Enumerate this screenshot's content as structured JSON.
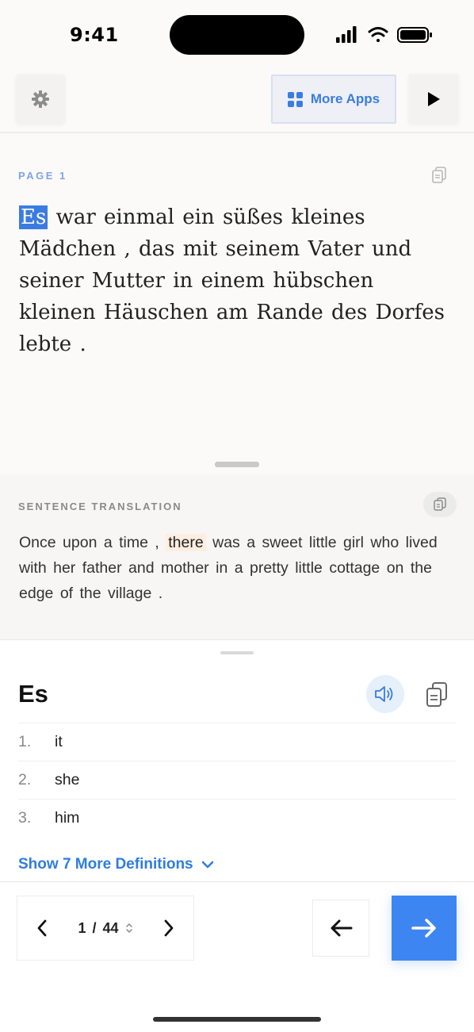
{
  "status_bar": {
    "time": "9:41"
  },
  "toolbar": {
    "more_apps_label": "More Apps"
  },
  "reading": {
    "page_label": "PAGE 1",
    "words": [
      "Es",
      "war",
      "einmal",
      "ein",
      "süßes",
      "kleines",
      "Mädchen",
      ",",
      "das",
      "mit",
      "seinem",
      "Vater",
      "und",
      "seiner",
      "Mutter",
      "in",
      "einem",
      "hübschen",
      "kleinen",
      "Häuschen",
      "am",
      "Rande",
      "des",
      "Dorfes",
      "lebte",
      "."
    ],
    "active_word": "Es"
  },
  "translation": {
    "label": "SENTENCE TRANSLATION",
    "words": [
      "Once",
      "upon",
      "a",
      "time",
      ",",
      "there",
      "was",
      "a",
      "sweet",
      "little",
      "girl",
      "who",
      "lived",
      "with",
      "her",
      "father",
      "and",
      "mother",
      "in",
      "a",
      "pretty",
      "little",
      "cottage",
      "on",
      "the",
      "edge",
      "of",
      "the",
      "village",
      "."
    ],
    "highlighted_word": "there"
  },
  "definition": {
    "word": "Es",
    "items": [
      {
        "num": "1.",
        "text": "it"
      },
      {
        "num": "2.",
        "text": "she"
      },
      {
        "num": "3.",
        "text": "him"
      }
    ],
    "more_label": "Show 7 More Definitions"
  },
  "pager": {
    "current": "1",
    "separator": "/",
    "total": "44"
  },
  "colors": {
    "accent": "#3d86f2",
    "highlight": "#fdeee0",
    "active_word_bg": "#3b7ce0"
  },
  "icons": [
    "gear-icon",
    "grid-icon",
    "play-icon",
    "copy-icon",
    "speaker-icon",
    "chevron-down-icon",
    "chevron-left-icon",
    "chevron-right-icon",
    "sort-icon",
    "arrow-left-icon",
    "arrow-right-icon"
  ]
}
